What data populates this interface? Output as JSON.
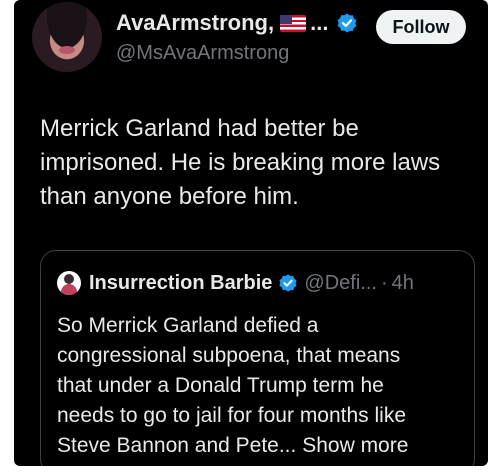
{
  "author": {
    "display_name": "AvaArmstrong,",
    "ellipsis": "...",
    "handle": "@MsAvaArmstrong",
    "verified": true,
    "flag": "us-flag-icon"
  },
  "follow_label": "Follow",
  "tweet": {
    "line1": "Merrick Garland had better be",
    "line2": "imprisoned.  He is breaking more laws",
    "line3": "than anyone before him."
  },
  "quote": {
    "display_name": "Insurrection Barbie",
    "handle": "@Defi...",
    "separator": "·",
    "time": "4h",
    "line1": "So Merrick Garland defied a",
    "line2": "congressional subpoena, that means",
    "line3": "that under a Donald Trump term he",
    "line4": "needs to go to jail for four months like",
    "line5_text": "Steve Bannon and Pete...",
    "show_more": "Show more"
  },
  "colors": {
    "background": "#000000",
    "text": "#e7e9ea",
    "muted": "#71767b",
    "verified": "#1d9bf0",
    "follow_bg": "#eff3f4"
  }
}
